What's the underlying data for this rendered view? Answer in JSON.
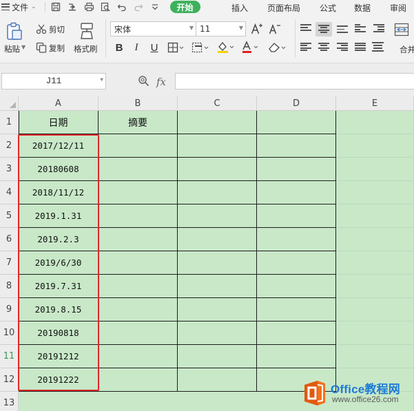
{
  "menu": {
    "file_label": "文件",
    "tabs": [
      "开始",
      "插入",
      "页面布局",
      "公式",
      "数据",
      "审阅"
    ]
  },
  "ribbon": {
    "paste_label": "粘贴",
    "cut_label": "剪切",
    "copy_label": "复制",
    "format_painter_label": "格式刷",
    "font_name": "宋体",
    "font_size": "11",
    "merge_label": "合并"
  },
  "formula_bar": {
    "name_box": "J11",
    "fx_label": "fx",
    "formula": ""
  },
  "sheet": {
    "columns": [
      "A",
      "B",
      "C",
      "D",
      "E"
    ],
    "rows": [
      "1",
      "2",
      "3",
      "4",
      "5",
      "6",
      "7",
      "8",
      "9",
      "10",
      "11",
      "12",
      "13"
    ],
    "headers": {
      "A": "日期",
      "B": "摘要"
    },
    "dates": [
      "2017/12/11",
      "20180608",
      "2018/11/12",
      "2019.1.31",
      "2019.2.3",
      "2019/6/30",
      "2019.7.31",
      "2019.8.15",
      "20190818",
      "20191212",
      "20191222"
    ],
    "active_row": "11",
    "selection_color": "#e0272a",
    "cell_fill": "#c8e8c8"
  },
  "watermark": {
    "title": "Office教程网",
    "url": "www.office26.com"
  },
  "colors": {
    "accent": "#3cb15b",
    "watermark_blue": "#1e7bd6",
    "watermark_orange": "#f2711c"
  }
}
